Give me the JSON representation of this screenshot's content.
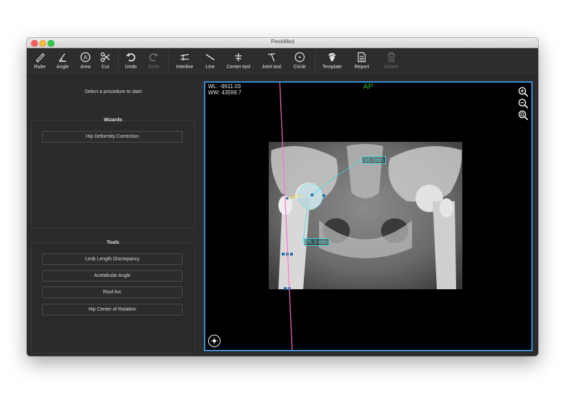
{
  "window": {
    "title": "PeekMed"
  },
  "toolbar": {
    "ruler": "Ruler",
    "angle": "Angle",
    "area": "Area",
    "cut": "Cut",
    "undo": "Undo",
    "redo": "Redo",
    "interline": "Interline",
    "line": "Line",
    "center_tool": "Center tool",
    "joint_tool": "Joint tool",
    "circle": "Circle",
    "template": "Template",
    "report": "Report",
    "delete": "Delete"
  },
  "sidebar": {
    "prompt": "Select a procedure to start:",
    "wizards": {
      "title": "Wizards",
      "items": [
        "Hip Deformity Correction"
      ]
    },
    "tools": {
      "title": "Tools",
      "items": [
        "Limb Length Discrepancy",
        "Acetabular Angle",
        "Roof Arc",
        "Hip Center of Rotation"
      ]
    }
  },
  "viewer": {
    "wl": "WL: -9911.03",
    "ww": "WW: 43599.7",
    "view_label": "AP",
    "measurements": [
      "16.7mm",
      "35.3 mm"
    ],
    "icons": [
      "zoom-in-icon",
      "zoom-out-icon",
      "zoom-fit-icon",
      "brightness-icon"
    ]
  },
  "colors": {
    "accent_border": "#3d8fd6",
    "measure": "#37e0e8",
    "view_label": "#20b820",
    "axis_line": "#ff6ec7"
  }
}
